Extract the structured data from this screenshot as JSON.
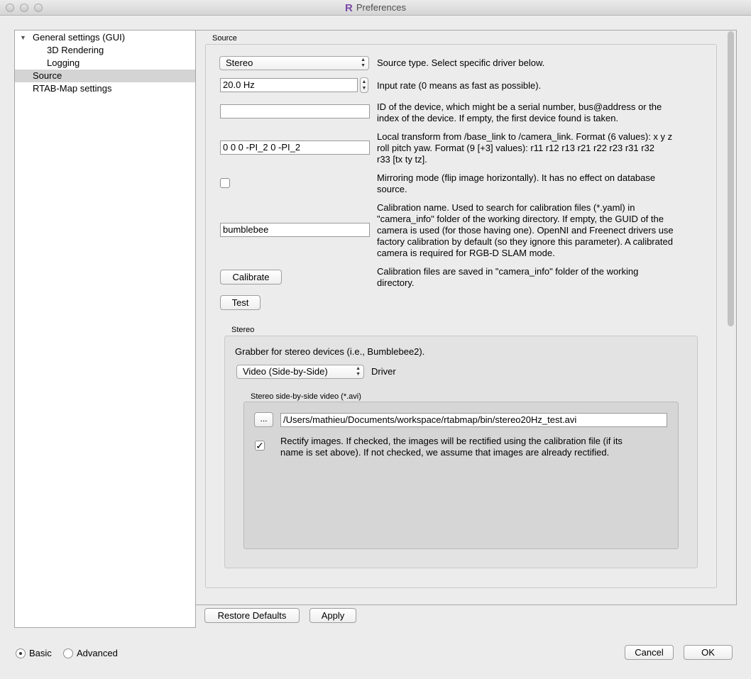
{
  "window": {
    "title": "Preferences",
    "logo_letter": "R"
  },
  "tree": {
    "items": [
      {
        "label": "General settings (GUI)"
      },
      {
        "label": "3D Rendering"
      },
      {
        "label": "Logging"
      },
      {
        "label": "Source"
      },
      {
        "label": "RTAB-Map settings"
      }
    ]
  },
  "source": {
    "group_title": "Source",
    "source_type": {
      "value": "Stereo",
      "desc": "Source type. Select specific driver below."
    },
    "input_rate": {
      "value": "20.0 Hz",
      "desc": "Input rate (0 means as fast as possible)."
    },
    "device_id": {
      "value": "",
      "desc_1": "ID of the device, which might be a serial number, bus@address or the",
      "desc_2": "index of the device. If empty, the first device found is taken."
    },
    "local_transform": {
      "value": "0 0 0 -PI_2 0 -PI_2",
      "desc_1": "Local transform from /base_link to /camera_link. Format (6 values): x y z",
      "desc_2": "roll pitch yaw. Format (9 [+3] values): r11 r12 r13 r21 r22 r23 r31 r32",
      "desc_3": "r33 [tx ty tz]."
    },
    "mirroring": {
      "checked": false,
      "desc_1": "Mirroring mode (flip image horizontally). It has no effect on database",
      "desc_2": "source."
    },
    "calibration_name": {
      "value": "bumblebee",
      "desc_1": "Calibration name. Used to search for calibration files (*.yaml) in",
      "desc_2": "\"camera_info\" folder of the working directory. If empty, the GUID of the",
      "desc_3": "camera is used (for those having one). OpenNI and Freenect drivers use",
      "desc_4": "factory calibration by default (so they ignore this parameter). A calibrated",
      "desc_5": "camera is required for RGB-D SLAM mode."
    },
    "calibrate_button": "Calibrate",
    "calibrate_desc_1": "Calibration files are saved in \"camera_info\" folder of the working",
    "calibrate_desc_2": "directory.",
    "test_button": "Test"
  },
  "stereo": {
    "group_title": "Stereo",
    "description": "Grabber for stereo devices (i.e., Bumblebee2).",
    "driver_value": "Video (Side-by-Side)",
    "driver_label": "Driver",
    "video_group_title": "Stereo side-by-side video (*.avi)",
    "browse_button": "...",
    "path": "/Users/mathieu/Documents/workspace/rtabmap/bin/stereo20Hz_test.avi",
    "rectify": {
      "checked": true,
      "checkmark": "✓",
      "desc_1": "Rectify images. If checked, the images will be rectified using the calibration file (if its",
      "desc_2": "name is set above). If not checked, we assume that images are already rectified."
    }
  },
  "footer": {
    "restore_defaults": "Restore Defaults",
    "apply": "Apply",
    "basic": "Basic",
    "advanced": "Advanced",
    "mode_selected": "Basic",
    "cancel": "Cancel",
    "ok": "OK"
  }
}
